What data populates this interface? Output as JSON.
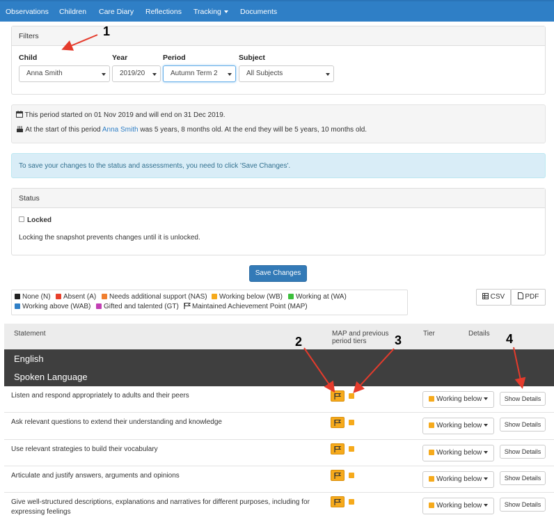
{
  "nav": {
    "items": [
      "Observations",
      "Children",
      "Care Diary",
      "Reflections",
      "Tracking",
      "Documents"
    ]
  },
  "filters": {
    "title": "Filters",
    "child_label": "Child",
    "child_value": "Anna Smith",
    "year_label": "Year",
    "year_value": "2019/20",
    "period_label": "Period",
    "period_value": "Autumn Term 2",
    "subject_label": "Subject",
    "subject_value": "All Subjects"
  },
  "info": {
    "period_text": "This period started on 01 Nov 2019 and will end on 31 Dec 2019.",
    "age_prefix": "At the start of this period",
    "child_link": "Anna Smith",
    "age_suffix": "was 5 years, 8 months old. At the end they will be 5 years, 10 months old."
  },
  "alert": {
    "text": "To save your changes to the status and assessments, you need to click 'Save Changes'."
  },
  "status": {
    "title": "Status",
    "locked_label": "Locked",
    "note": "Locking the snapshot prevents changes until it is unlocked."
  },
  "save_label": "Save Changes",
  "legend": {
    "items": [
      {
        "label": "None (N)",
        "color": "#222222"
      },
      {
        "label": "Absent (A)",
        "color": "#e8402c"
      },
      {
        "label": "Needs additional support (NAS)",
        "color": "#f07f2f"
      },
      {
        "label": "Working below (WB)",
        "color": "#f6aa1c"
      },
      {
        "label": "Working at (WA)",
        "color": "#3cbf3c"
      },
      {
        "label": "Working above (WAB)",
        "color": "#2f7fc6"
      },
      {
        "label": "Gifted and talented (GT)",
        "color": "#c23fb4"
      },
      {
        "label": "Maintained Achievement Point (MAP)",
        "icon": "flag-icon"
      }
    ]
  },
  "export": {
    "csv": "CSV",
    "pdf": "PDF"
  },
  "table": {
    "headers": {
      "statement": "Statement",
      "map_line1": "MAP and previous",
      "map_line2": "period tiers",
      "tier": "Tier",
      "details": "Details"
    },
    "subject": "English",
    "section": "Spoken Language",
    "rows": [
      {
        "statement": "Listen and respond appropriately to adults and their peers",
        "tier": "Working below",
        "details": "Show Details"
      },
      {
        "statement": "Ask relevant questions to extend their understanding and knowledge",
        "tier": "Working below",
        "details": "Show Details"
      },
      {
        "statement": "Use relevant strategies to build their vocabulary",
        "tier": "Working below",
        "details": "Show Details"
      },
      {
        "statement": "Articulate and justify answers, arguments and opinions",
        "tier": "Working below",
        "details": "Show Details"
      },
      {
        "statement": "Give well-structured descriptions, explanations and narratives for different purposes, including for",
        "statement_line2": "expressing feelings",
        "tier": "Working below",
        "details": "Show Details"
      }
    ]
  },
  "annotations": [
    "1",
    "2",
    "3",
    "4"
  ],
  "colors": {
    "nav": "#2f7fc6",
    "working_below": "#f6aa1c",
    "arrow": "#e53b2c"
  }
}
